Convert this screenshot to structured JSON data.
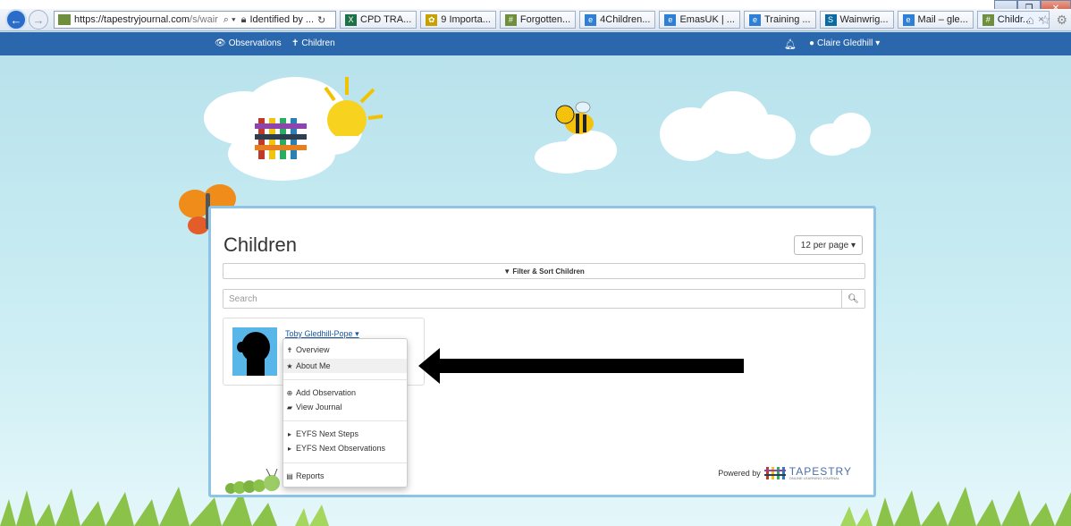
{
  "browser": {
    "url_main": "https://tapestryjournal.com",
    "url_rest": "/s/wair",
    "identity": "Identified by ...",
    "tabs": [
      {
        "label": "CPD TRA...",
        "icon": "excel-icon",
        "color": "#1e7145"
      },
      {
        "label": "9 Importa...",
        "icon": "flower-icon",
        "color": "#c8a000"
      },
      {
        "label": "Forgotten...",
        "icon": "tapestry-icon",
        "color": "#6f8f3c"
      },
      {
        "label": "4Children...",
        "icon": "ie-icon",
        "color": "#2f7fd6"
      },
      {
        "label": "EmasUK | ...",
        "icon": "ie-icon",
        "color": "#2f7fd6"
      },
      {
        "label": "Training ...",
        "icon": "ie-icon",
        "color": "#2f7fd6"
      },
      {
        "label": "Wainwrig...",
        "icon": "sharepoint-icon",
        "color": "#0b6aa2"
      },
      {
        "label": "Mail – gle...",
        "icon": "ie-icon",
        "color": "#2f7fd6"
      },
      {
        "label": "Childr...",
        "icon": "tapestry-icon",
        "color": "#6f8f3c",
        "active": true
      }
    ]
  },
  "nav": {
    "observations": "Observations",
    "children": "Children",
    "user": "Claire Gledhill"
  },
  "main": {
    "title": "Children",
    "per_page": "12 per page",
    "filter": "Filter & Sort Children",
    "search_placeholder": "Search"
  },
  "child": {
    "name": "Toby Gledhill-Pope"
  },
  "menu": {
    "overview": "Overview",
    "about_me": "About Me",
    "add_observation": "Add Observation",
    "view_journal": "View Journal",
    "eyfs_next_steps": "EYFS Next Steps",
    "eyfs_next_observations": "EYFS Next Observations",
    "reports": "Reports"
  },
  "footer": {
    "powered_by": "Powered by",
    "brand": "TAPESTRY",
    "brand_sub": "ONLINE LEARNING JOURNAL"
  },
  "colors": {
    "nav_bar": "#2a67ad",
    "panel_border": "#8ec4e6",
    "link": "#1d5aa6"
  }
}
